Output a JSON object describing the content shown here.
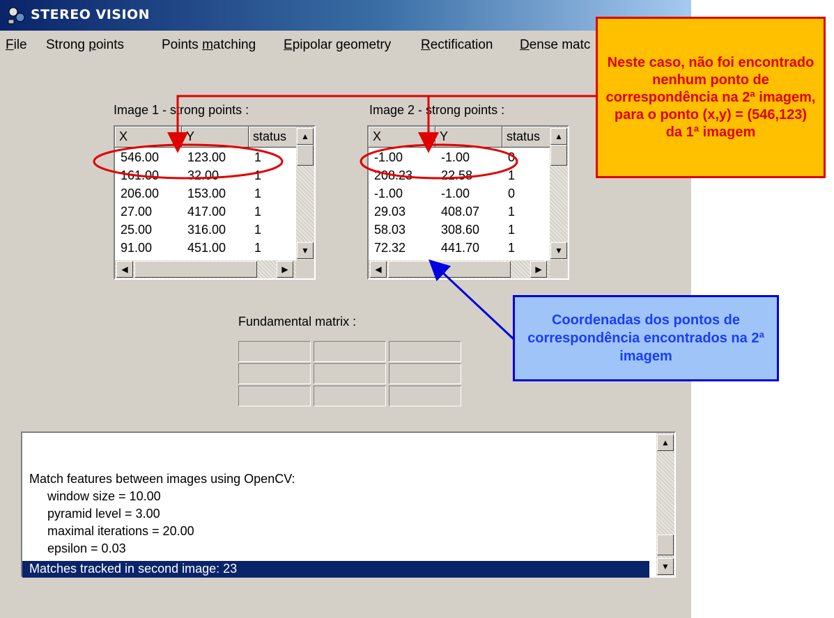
{
  "window": {
    "title": "STEREO VISION",
    "icon": "app-icon"
  },
  "menu": [
    {
      "pre": "",
      "mn": "F",
      "post": "ile"
    },
    {
      "pre": "Strong ",
      "mn": "p",
      "post": "oints"
    },
    {
      "pre": "Points ",
      "mn": "m",
      "post": "atching"
    },
    {
      "pre": "",
      "mn": "E",
      "post": "pipolar geometry"
    },
    {
      "pre": "",
      "mn": "R",
      "post": "ectification"
    },
    {
      "pre": "",
      "mn": "D",
      "post": "ense matc"
    }
  ],
  "image1": {
    "label": "Image 1 - strong points :",
    "columns": [
      "X",
      "Y",
      "status"
    ],
    "rows": [
      [
        "546.00",
        "123.00",
        "1"
      ],
      [
        "161.00",
        "32.00",
        "1"
      ],
      [
        "206.00",
        "153.00",
        "1"
      ],
      [
        "27.00",
        "417.00",
        "1"
      ],
      [
        "25.00",
        "316.00",
        "1"
      ],
      [
        "91.00",
        "451.00",
        "1"
      ]
    ]
  },
  "image2": {
    "label": "Image 2 - strong points :",
    "columns": [
      "X",
      "Y",
      "status"
    ],
    "rows": [
      [
        "-1.00",
        "-1.00",
        "0"
      ],
      [
        "208.23",
        "22.58",
        "1"
      ],
      [
        "-1.00",
        "-1.00",
        "0"
      ],
      [
        "29.03",
        "408.07",
        "1"
      ],
      [
        "58.03",
        "308.60",
        "1"
      ],
      [
        "72.32",
        "441.70",
        "1"
      ]
    ]
  },
  "fundamental": {
    "label": "Fundamental matrix :"
  },
  "log": {
    "lines": [
      {
        "text": "Match features between images using OpenCV:",
        "indent": false
      },
      {
        "text": "window size = 10.00",
        "indent": true
      },
      {
        "text": "pyramid level = 3.00",
        "indent": true
      },
      {
        "text": "maximal iterations = 20.00",
        "indent": true
      },
      {
        "text": "epsilon = 0.03",
        "indent": true
      }
    ],
    "selected": "Matches tracked in second image: 23"
  },
  "annotations": {
    "top_note": "Neste caso, não foi encontrado nenhum ponto de correspondência na 2ª imagem, para o ponto (x,y) = (546,123) da 1ª imagem",
    "bottom_note": "Coordenadas dos pontos de correspondência encontrados na 2ª imagem",
    "red": "#e00000",
    "blue": "#0000e0",
    "orange": "#ffc000",
    "light_blue": "#9fc5f8"
  },
  "icons": {
    "scroll_up": "▲",
    "scroll_down": "▼",
    "scroll_left": "◀",
    "scroll_right": "▶"
  }
}
